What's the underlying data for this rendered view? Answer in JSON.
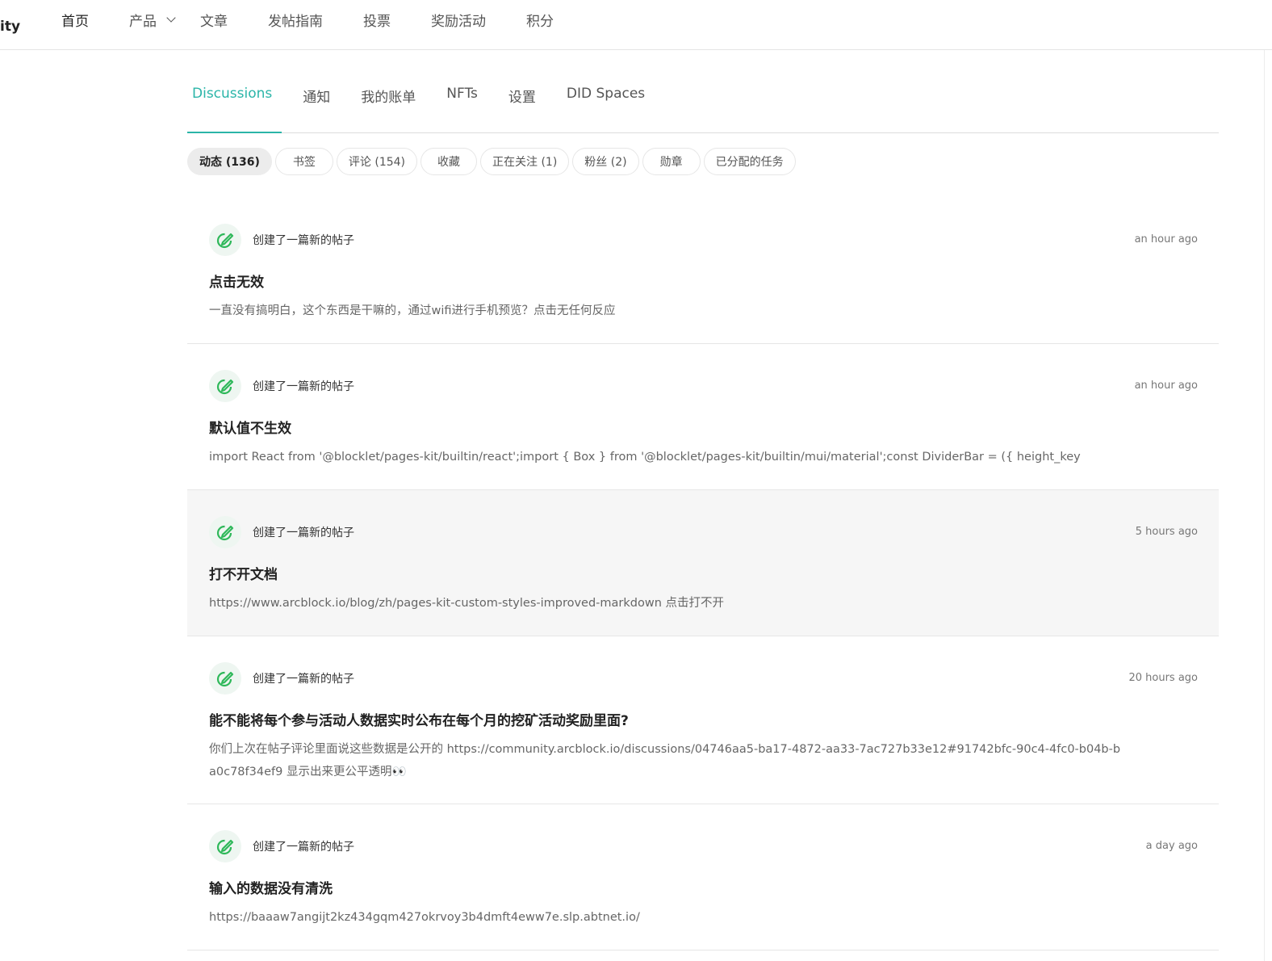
{
  "header": {
    "brand": "ity",
    "nav": [
      {
        "label": "首页"
      },
      {
        "label": "产品"
      },
      {
        "label": "文章"
      },
      {
        "label": "发帖指南"
      },
      {
        "label": "投票"
      },
      {
        "label": "奖励活动"
      },
      {
        "label": "积分"
      }
    ]
  },
  "tabs": [
    {
      "label": "Discussions"
    },
    {
      "label": "通知"
    },
    {
      "label": "我的账单"
    },
    {
      "label": "NFTs"
    },
    {
      "label": "设置"
    },
    {
      "label": "DID Spaces"
    }
  ],
  "chips": [
    {
      "label": "动态 (136)"
    },
    {
      "label": "书签"
    },
    {
      "label": "评论 (154)"
    },
    {
      "label": "收藏"
    },
    {
      "label": "正在关注 (1)"
    },
    {
      "label": "粉丝 (2)"
    },
    {
      "label": "勋章"
    },
    {
      "label": "已分配的任务"
    }
  ],
  "feed": [
    {
      "action": "创建了一篇新的帖子",
      "time": "an hour ago",
      "title": "点击无效",
      "excerpt": "一直没有搞明白，这个东西是干嘛的，通过wifi进行手机预览？点击无任何反应"
    },
    {
      "action": "创建了一篇新的帖子",
      "time": "an hour ago",
      "title": "默认值不生效",
      "excerpt": "import React from '@blocklet/pages-kit/builtin/react';import { Box } from '@blocklet/pages-kit/builtin/mui/material';const DividerBar = ({ height_key"
    },
    {
      "action": "创建了一篇新的帖子",
      "time": "5 hours ago",
      "title": "打不开文档",
      "excerpt": "https://www.arcblock.io/blog/zh/pages-kit-custom-styles-improved-markdown 点击打不开"
    },
    {
      "action": "创建了一篇新的帖子",
      "time": "20 hours ago",
      "title": "能不能将每个参与活动人数据实时公布在每个月的挖矿活动奖励里面?",
      "excerpt": "你们上次在帖子评论里面说这些数据是公开的 https://community.arcblock.io/discussions/04746aa5-ba17-4872-aa33-7ac727b33e12#91742bfc-90c4-4fc0-b04b-ba0c78f34ef9 显示出来更公平透明👀"
    },
    {
      "action": "创建了一篇新的帖子",
      "time": "a day ago",
      "title": "输入的数据没有清洗",
      "excerpt": "https://baaaw7angijt2kz434gqm427okrvoy3b4dmft4eww7e.slp.abtnet.io/"
    }
  ],
  "colors": {
    "accent": "#2bb5a8",
    "icon_green": "#2fb85a"
  },
  "icons": {
    "post_icon": "edit-link-icon"
  }
}
